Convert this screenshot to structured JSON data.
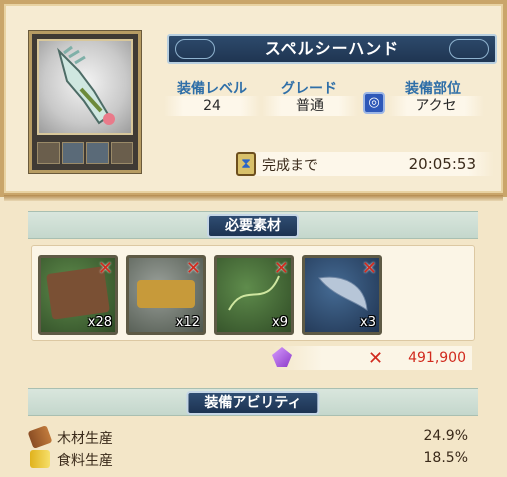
{
  "item": {
    "name": "スペルシーハンド",
    "stats": {
      "level_label": "装備レベル",
      "level_value": "24",
      "grade_label": "グレード",
      "grade_value": "普通",
      "slot_label": "装備部位",
      "slot_value": "アクセ",
      "slot_icon": "ring-icon"
    },
    "timer": {
      "label": "完成まで",
      "value": "20:05:53",
      "icon": "hourglass-icon"
    }
  },
  "materials": {
    "header": "必要素材",
    "items": [
      {
        "name": "leather",
        "quantity": "x28",
        "missing": true
      },
      {
        "name": "comb",
        "quantity": "x12",
        "missing": true
      },
      {
        "name": "thread",
        "quantity": "x9",
        "missing": true
      },
      {
        "name": "wing",
        "quantity": "x3",
        "missing": true
      }
    ],
    "cost": {
      "icon": "crystal-icon",
      "value": "491,900",
      "insufficient": true
    }
  },
  "abilities": {
    "header": "装備アビリティ",
    "rows": [
      {
        "label": "木材生産",
        "value": "24.9%",
        "icon": "wood-icon"
      },
      {
        "label": "食料生産",
        "value": "18.5%",
        "icon": "food-icon"
      }
    ]
  },
  "colors": {
    "banner": "#1f3552",
    "stat_label": "#2f6fa8",
    "missing_red": "#d12a1e",
    "background": "#f3e6c8"
  }
}
